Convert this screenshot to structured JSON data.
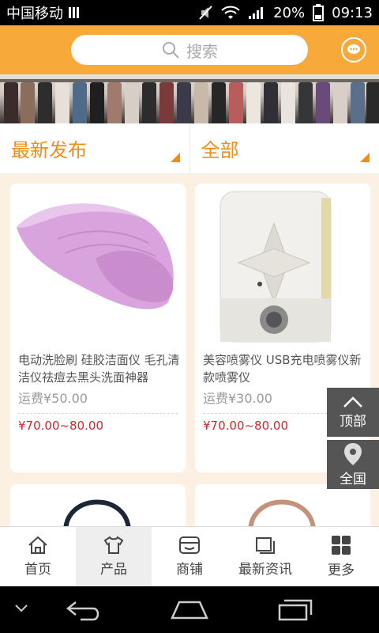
{
  "status": {
    "carrier": "中国移动",
    "battery": "20%",
    "time": "09:13"
  },
  "header": {
    "search_placeholder": "搜索"
  },
  "filters": [
    {
      "label": "最新发布"
    },
    {
      "label": "全部"
    }
  ],
  "products": [
    {
      "title": "电动洗脸刷 硅胶洁面仪 毛孔清洁仪祛痘去黑头洗面神器",
      "shipping": "运费¥50.00",
      "price": "¥70.00~80.00"
    },
    {
      "title": "美容喷雾仪 USB充电喷雾仪新款喷雾仪",
      "shipping": "运费¥30.00",
      "price": "¥70.00~80.00"
    }
  ],
  "side_buttons": {
    "top": "顶部",
    "region": "全国"
  },
  "tabs": [
    {
      "label": "首页",
      "icon": "home-icon"
    },
    {
      "label": "产品",
      "icon": "shirt-icon"
    },
    {
      "label": "商铺",
      "icon": "shop-icon"
    },
    {
      "label": "最新资讯",
      "icon": "news-icon"
    },
    {
      "label": "更多",
      "icon": "grid-icon"
    }
  ],
  "colors": {
    "accent": "#f7a93a",
    "filter_text": "#f28c1a",
    "price": "#d4242b",
    "content_bg": "#fbf0e2"
  }
}
